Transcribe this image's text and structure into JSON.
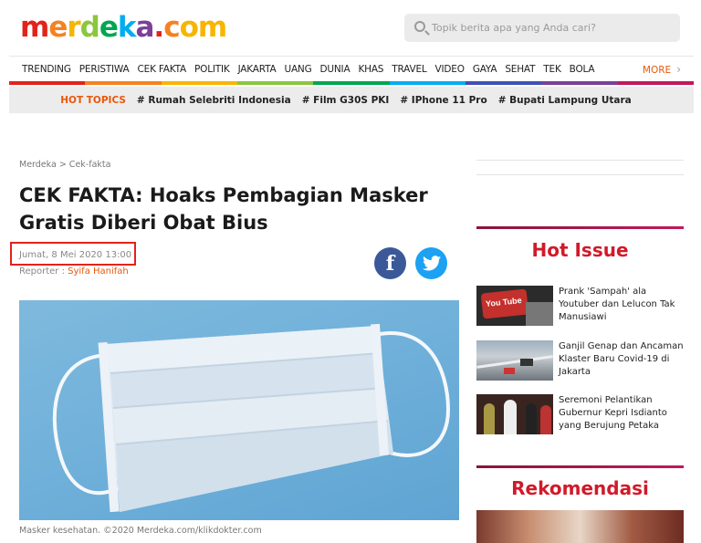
{
  "logo": {
    "parts": [
      {
        "text": "m",
        "color": "#e2231a"
      },
      {
        "text": "e",
        "color": "#f58220"
      },
      {
        "text": "r",
        "color": "#f7b500"
      },
      {
        "text": "d",
        "color": "#8cc63f"
      },
      {
        "text": "e",
        "color": "#00a651"
      },
      {
        "text": "k",
        "color": "#00aeef"
      },
      {
        "text": "a",
        "color": "#7b3f98"
      },
      {
        "text": ".",
        "color": "#e2231a"
      },
      {
        "text": "c",
        "color": "#f58220"
      },
      {
        "text": "o",
        "color": "#f7b500"
      },
      {
        "text": "m",
        "color": "#f7b500"
      }
    ]
  },
  "search": {
    "placeholder": "Topik berita apa yang Anda cari?"
  },
  "nav": {
    "items": [
      "TRENDING",
      "PERISTIWA",
      "CEK FAKTA",
      "POLITIK",
      "JAKARTA",
      "UANG",
      "DUNIA",
      "KHAS",
      "TRAVEL",
      "VIDEO",
      "GAYA",
      "SEHAT",
      "TEK",
      "BOLA"
    ],
    "more_label": "MORE",
    "rainbow": [
      "#e2231a",
      "#f58220",
      "#f7b500",
      "#8cc63f",
      "#00a651",
      "#00aeef",
      "#3f51b5",
      "#7b3f98",
      "#c2185b"
    ]
  },
  "hot_topics": {
    "label": "HOT TOPICS",
    "items": [
      "# Rumah Selebriti Indonesia",
      "# Film G30S PKI",
      "# IPhone 11 Pro",
      "# Bupati Lampung Utara"
    ]
  },
  "article": {
    "breadcrumb": "Merdeka > Cek-fakta",
    "title": "CEK FAKTA: Hoaks Pembagian Masker Gratis Diberi Obat Bius",
    "date": "Jumat, 8 Mei 2020 13:00",
    "reporter_label": "Reporter : ",
    "reporter_name": "Syifa Hanifah",
    "caption": "Masker kesehatan. ©2020 Merdeka.com/klikdokter.com"
  },
  "sidebar": {
    "hot_issue_title": "Hot Issue",
    "hot_issues": [
      {
        "text": "Prank 'Sampah' ala Youtuber dan Lelucon Tak Manusiawi"
      },
      {
        "text": "Ganjil Genap dan Ancaman Klaster Baru Covid-19 di Jakarta"
      },
      {
        "text": "Seremoni Pelantikan Gubernur Kepri Isdianto yang Berujung Petaka"
      }
    ],
    "rekomendasi_title": "Rekomendasi",
    "youtube_label": "You Tube"
  },
  "colors": {
    "accent": "#e8580c",
    "heading_red": "#d11a2a",
    "highlight_box": "#e2231a"
  }
}
